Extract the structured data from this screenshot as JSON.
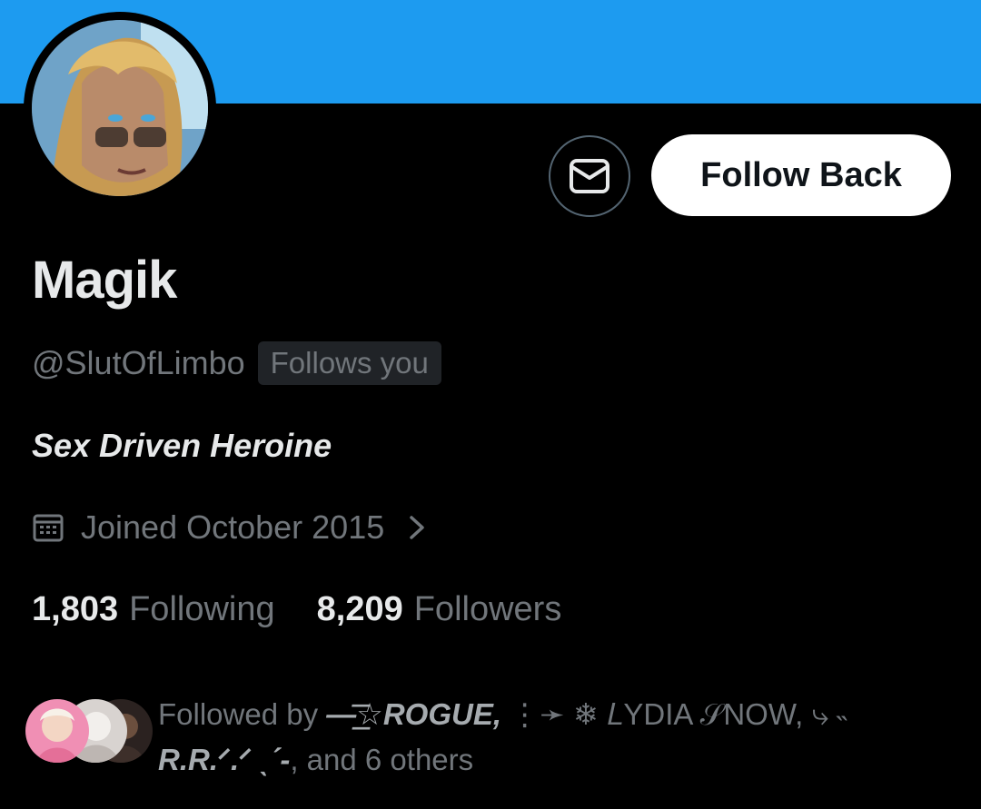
{
  "profile": {
    "name": "Magik",
    "handle": "@SlutOfLimbo",
    "follows_you_label": "Follows you",
    "bio": "Sex Driven Heroine",
    "joined": "Joined October 2015"
  },
  "actions": {
    "message_icon": "envelope-icon",
    "follow_back_label": "Follow Back"
  },
  "stats": {
    "following_count": "1,803",
    "following_label": "Following",
    "followers_count": "8,209",
    "followers_label": "Followers"
  },
  "followed_by": {
    "prefix": "Followed by ",
    "user1": "—͟͞☆ROGUE,",
    "mid": " ⋮➛ ❄ 𝐿YDIA 𝒮NOW, ⤷ ˵",
    "user2": "R.R.ᐟ.ᐟ ˎˊ-",
    "suffix": ", and 6 others"
  },
  "colors": {
    "banner": "#1d9bf0",
    "background": "#000000",
    "text_primary": "#e7e9ea",
    "text_secondary": "#71767b",
    "follow_button_bg": "#ffffff"
  }
}
